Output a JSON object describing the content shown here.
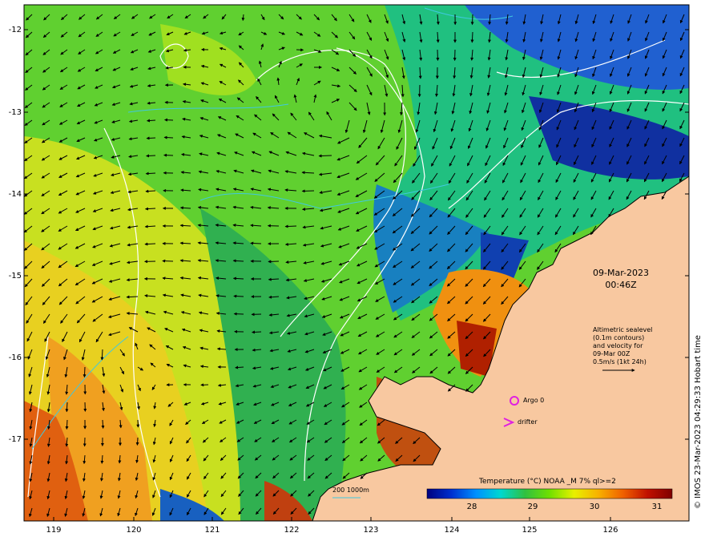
{
  "map": {
    "date_line1": "09-Mar-2023",
    "date_line2": "00:46Z",
    "altimetry_note": [
      "Altimetric sealevel",
      "(0.1m contours)",
      "and velocity for",
      "09-Mar 00Z",
      "0.5m/s (1kt 24h)"
    ],
    "legend": {
      "argo_label": "Argo 0",
      "argo_color": "#e020e0",
      "drifter_label": "drifter",
      "drifter_color": "#e020e0"
    },
    "colorbar": {
      "title": "Temperature (°C) NOAA _M 7% ql>=2",
      "ticks": [
        "28",
        "29",
        "30",
        "31"
      ],
      "colors": [
        "#00007f",
        "#0030d0",
        "#0090ff",
        "#00d8d0",
        "#30c040",
        "#70e000",
        "#e8f000",
        "#f8b000",
        "#f06000",
        "#c01000",
        "#7f0000"
      ]
    },
    "depth_legend": "200  1000m",
    "depth_color": "#40c8e0",
    "land_color": "#f8c8a0",
    "longitude_ticks": [
      "119",
      "120",
      "121",
      "122",
      "123",
      "124",
      "125",
      "126"
    ],
    "latitude_ticks": [
      "-12",
      "-13",
      "-14",
      "-15",
      "-16",
      "-17"
    ],
    "copyright": "© IMOS 23-Mar-2023 04:29:33 Hobart time"
  }
}
